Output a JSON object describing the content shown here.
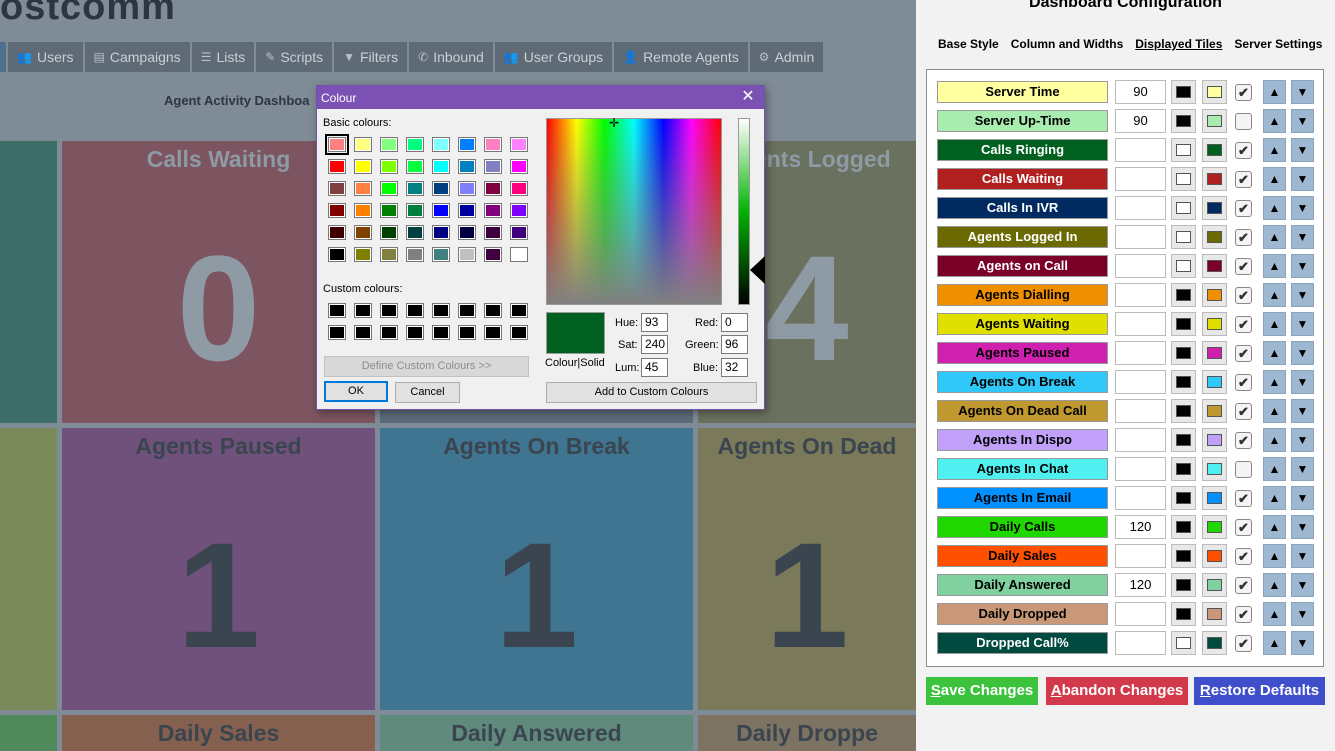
{
  "background": {
    "brand": "ostcomm",
    "nav": [
      {
        "label": "Users",
        "icon": "users-icon",
        "glyph": "👥"
      },
      {
        "label": "Campaigns",
        "icon": "campaigns-icon",
        "glyph": "▤"
      },
      {
        "label": "Lists",
        "icon": "lists-icon",
        "glyph": "☰"
      },
      {
        "label": "Scripts",
        "icon": "scripts-icon",
        "glyph": "✎"
      },
      {
        "label": "Filters",
        "icon": "filter-icon",
        "glyph": "▼"
      },
      {
        "label": "Inbound",
        "icon": "phone-icon",
        "glyph": "✆"
      },
      {
        "label": "User Groups",
        "icon": "user-groups-icon",
        "glyph": "👥"
      },
      {
        "label": "Remote Agents",
        "icon": "remote-agents-icon",
        "glyph": "👤"
      },
      {
        "label": "Admin",
        "icon": "gear-icon",
        "glyph": "⚙"
      }
    ],
    "dashboard_title": "Agent Activity Dashboa",
    "tiles": [
      {
        "label": "",
        "value": "",
        "bg": "#3e6e68",
        "fg": "#8e9aa4"
      },
      {
        "label": "Calls Waiting",
        "value": "0",
        "bg": "#7c5560",
        "fg": "#8e9aa4"
      },
      {
        "label": "",
        "value": "",
        "bg": "#5b6b78",
        "fg": "#8e9aa4"
      },
      {
        "label": "Agents Logged",
        "value": "4",
        "bg": "#6a715e",
        "fg": "#8e9aa4"
      },
      {
        "label": "",
        "value": "",
        "bg": "#7b8a5a",
        "fg": "#3a4550"
      },
      {
        "label": "Agents Paused",
        "value": "1",
        "bg": "#70517c",
        "fg": "#3a4550"
      },
      {
        "label": "Agents On Break",
        "value": "1",
        "bg": "#3f7590",
        "fg": "#3a4550"
      },
      {
        "label": "Agents On Dead",
        "value": "1",
        "bg": "#7a7a5a",
        "fg": "#3a4550"
      },
      {
        "label": "",
        "value": "",
        "bg": "#4f8a5a",
        "fg": "#3a4550"
      },
      {
        "label": "Daily Sales",
        "value": "",
        "bg": "#85604f",
        "fg": "#3a4550"
      },
      {
        "label": "Daily Answered",
        "value": "",
        "bg": "#5f8a7c",
        "fg": "#3a4550"
      },
      {
        "label": "Daily Droppe",
        "value": "",
        "bg": "#7d7363",
        "fg": "#3a4550"
      }
    ]
  },
  "dialog": {
    "title": "Colour",
    "basic_label": "Basic colours:",
    "custom_label": "Custom colours:",
    "basic_colours": [
      "#ff8080",
      "#ffff80",
      "#80ff80",
      "#00ff80",
      "#80ffff",
      "#0080ff",
      "#ff80c0",
      "#ff80ff",
      "#ff0000",
      "#ffff00",
      "#80ff00",
      "#00ff40",
      "#00ffff",
      "#0080c0",
      "#8080c0",
      "#ff00ff",
      "#804040",
      "#ff8040",
      "#00ff00",
      "#008080",
      "#004080",
      "#8080ff",
      "#800040",
      "#ff0080",
      "#800000",
      "#ff8000",
      "#008000",
      "#008040",
      "#0000ff",
      "#0000a0",
      "#800080",
      "#8000ff",
      "#400000",
      "#804000",
      "#004000",
      "#004040",
      "#000080",
      "#000040",
      "#400040",
      "#400080",
      "#000000",
      "#808000",
      "#808040",
      "#808080",
      "#408080",
      "#c0c0c0",
      "#400040",
      "#ffffff"
    ],
    "custom_colours": [
      "#000000",
      "#000000",
      "#000000",
      "#000000",
      "#000000",
      "#000000",
      "#000000",
      "#000000",
      "#000000",
      "#000000",
      "#000000",
      "#000000",
      "#000000",
      "#000000",
      "#000000",
      "#000000"
    ],
    "define_custom": "Define Custom Colours >>",
    "ok": "OK",
    "cancel": "Cancel",
    "colour_solid": "Colour|Solid",
    "current_colour": "#006020",
    "hue_label": "Hue:",
    "hue": "93",
    "sat_label": "Sat:",
    "sat": "240",
    "lum_label": "Lum:",
    "lum": "45",
    "red_label": "Red:",
    "red": "0",
    "green_label": "Green:",
    "green": "96",
    "blue_label": "Blue:",
    "blue": "32",
    "add_custom": "Add to Custom Colours"
  },
  "panel": {
    "title": "Dashboard Configuration",
    "tabs": [
      "Base Style",
      "Column and Widths",
      "Displayed Tiles",
      "Server Settings"
    ],
    "active_tab": 2,
    "tiles": [
      {
        "name": "Server Time",
        "bg": "#ffffa0",
        "fg": "#000000",
        "width": "90",
        "c1": "#000000",
        "c2": "#ffffa0",
        "checked": true
      },
      {
        "name": "Server Up-Time",
        "bg": "#a8ecb0",
        "fg": "#000000",
        "width": "90",
        "c1": "#000000",
        "c2": "#a8ecb0",
        "checked": false
      },
      {
        "name": "Calls Ringing",
        "bg": "#006020",
        "fg": "#ffffff",
        "width": "",
        "c1": "#ffffff",
        "c2": "#006020",
        "checked": true
      },
      {
        "name": "Calls Waiting",
        "bg": "#b02020",
        "fg": "#ffffff",
        "width": "",
        "c1": "#ffffff",
        "c2": "#b02020",
        "checked": true
      },
      {
        "name": "Calls In IVR",
        "bg": "#002a60",
        "fg": "#ffffff",
        "width": "",
        "c1": "#ffffff",
        "c2": "#002a60",
        "checked": true
      },
      {
        "name": "Agents Logged In",
        "bg": "#6a6a00",
        "fg": "#ffffff",
        "width": "",
        "c1": "#ffffff",
        "c2": "#6a6a00",
        "checked": true
      },
      {
        "name": "Agents on Call",
        "bg": "#7a0028",
        "fg": "#ffffff",
        "width": "",
        "c1": "#ffffff",
        "c2": "#7a0028",
        "checked": true
      },
      {
        "name": "Agents Dialling",
        "bg": "#f09000",
        "fg": "#000000",
        "width": "",
        "c1": "#000000",
        "c2": "#f09000",
        "checked": true
      },
      {
        "name": "Agents Waiting",
        "bg": "#e0e000",
        "fg": "#000000",
        "width": "",
        "c1": "#000000",
        "c2": "#e0e000",
        "checked": true
      },
      {
        "name": "Agents Paused",
        "bg": "#d020b0",
        "fg": "#000000",
        "width": "",
        "c1": "#000000",
        "c2": "#d020b0",
        "checked": true
      },
      {
        "name": "Agents On Break",
        "bg": "#30c8f8",
        "fg": "#000000",
        "width": "",
        "c1": "#000000",
        "c2": "#30c8f8",
        "checked": true
      },
      {
        "name": "Agents On Dead Call",
        "bg": "#c09830",
        "fg": "#000000",
        "width": "",
        "c1": "#000000",
        "c2": "#c09830",
        "checked": true
      },
      {
        "name": "Agents In Dispo",
        "bg": "#c0a0f8",
        "fg": "#000000",
        "width": "",
        "c1": "#000000",
        "c2": "#c0a0f8",
        "checked": true
      },
      {
        "name": "Agents In Chat",
        "bg": "#50f0f0",
        "fg": "#000000",
        "width": "",
        "c1": "#000000",
        "c2": "#50f0f0",
        "checked": false
      },
      {
        "name": "Agents In Email",
        "bg": "#0090ff",
        "fg": "#000000",
        "width": "",
        "c1": "#000000",
        "c2": "#0090ff",
        "checked": true
      },
      {
        "name": "Daily Calls",
        "bg": "#20d800",
        "fg": "#000000",
        "width": "120",
        "c1": "#000000",
        "c2": "#20d800",
        "checked": true
      },
      {
        "name": "Daily Sales",
        "bg": "#ff5000",
        "fg": "#000000",
        "width": "",
        "c1": "#000000",
        "c2": "#ff5000",
        "checked": true
      },
      {
        "name": "Daily Answered",
        "bg": "#80d0a0",
        "fg": "#000000",
        "width": "120",
        "c1": "#000000",
        "c2": "#80d0a0",
        "checked": true
      },
      {
        "name": "Daily Dropped",
        "bg": "#c89878",
        "fg": "#000000",
        "width": "",
        "c1": "#000000",
        "c2": "#c89878",
        "checked": true
      },
      {
        "name": "Dropped Call%",
        "bg": "#004a40",
        "fg": "#ffffff",
        "width": "",
        "c1": "#ffffff",
        "c2": "#004a40",
        "checked": true
      }
    ],
    "up_glyph": "▲",
    "down_glyph": "▼",
    "check_glyph": "✔",
    "actions": [
      {
        "first": "S",
        "rest": "ave Changes",
        "bg": "#3cc23c"
      },
      {
        "first": "A",
        "rest": "bandon Changes",
        "bg": "#d23a4c"
      },
      {
        "first": "R",
        "rest": "estore Defaults",
        "bg": "#3f4fcc"
      }
    ]
  }
}
